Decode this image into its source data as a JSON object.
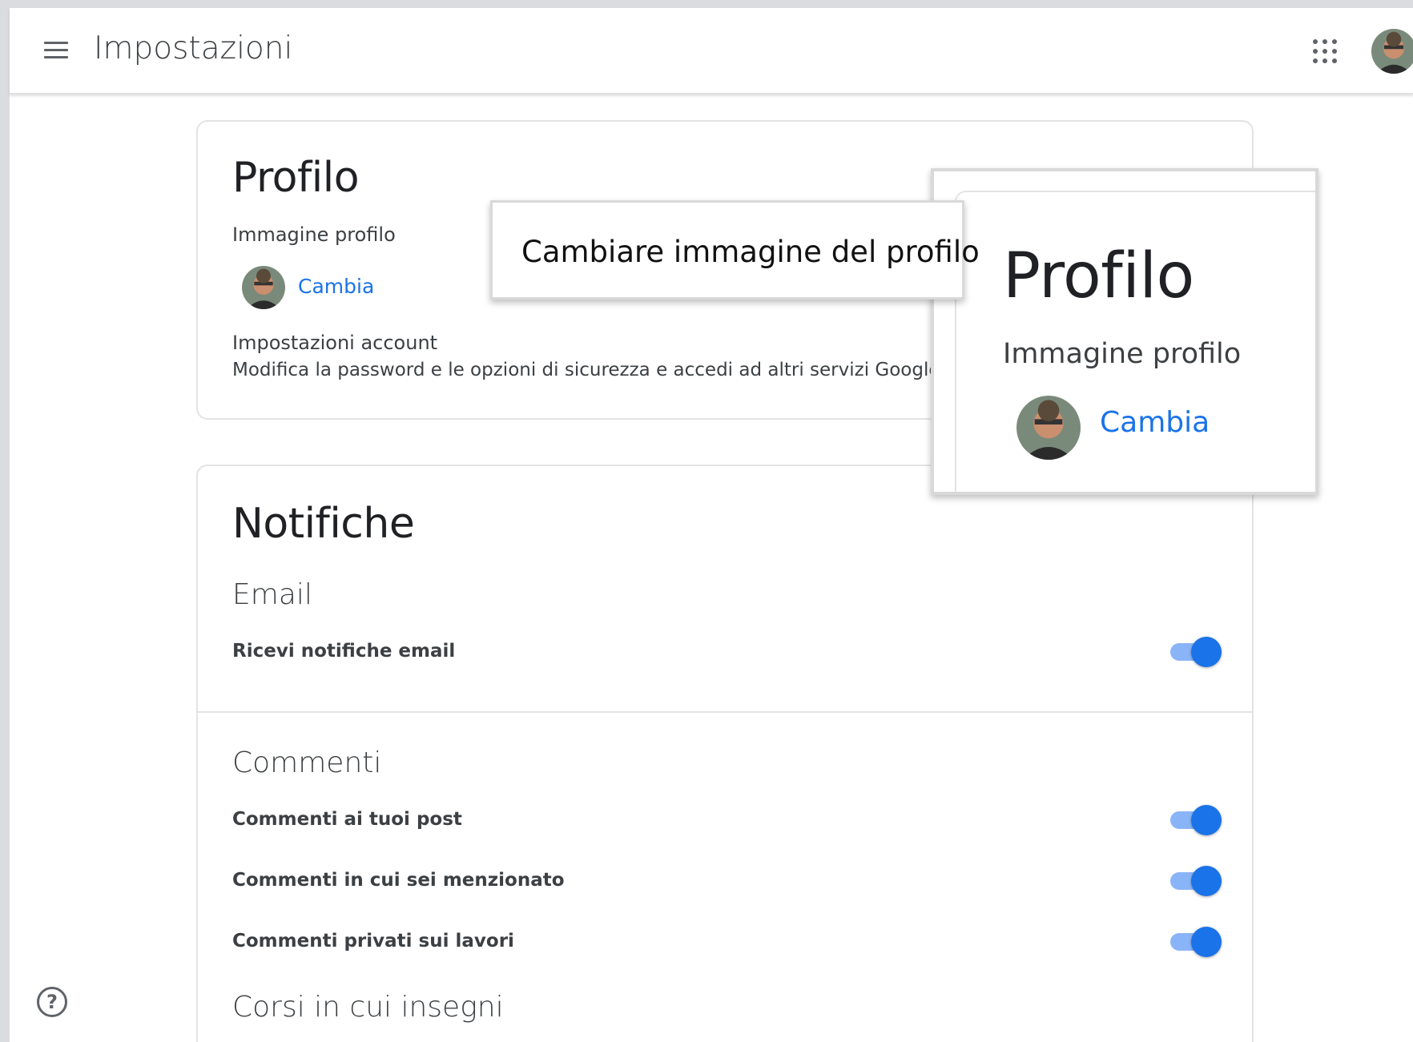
{
  "appbar": {
    "title": "Impostazioni"
  },
  "profile": {
    "title": "Profilo",
    "image_label": "Immagine profilo",
    "change_link": "Cambia",
    "account_label": "Impostazioni account",
    "account_desc": "Modifica la password e le opzioni di sicurezza e accedi ad altri servizi Google."
  },
  "callout": {
    "text": "Cambiare immagine del profilo"
  },
  "zoom": {
    "title": "Profilo",
    "image_label": "Immagine profilo",
    "change_link": "Cambia"
  },
  "notifications": {
    "title": "Notifiche",
    "email_section": "Email",
    "email_row": "Ricevi notifiche email",
    "comments_section": "Commenti",
    "comment_rows": [
      "Commenti ai tuoi post",
      "Commenti in cui sei menzionato",
      "Commenti privati sui lavori"
    ],
    "courses_section": "Corsi in cui insegni"
  },
  "colors": {
    "accent": "#1a73e8",
    "toggle_track": "#8ab4f8"
  }
}
